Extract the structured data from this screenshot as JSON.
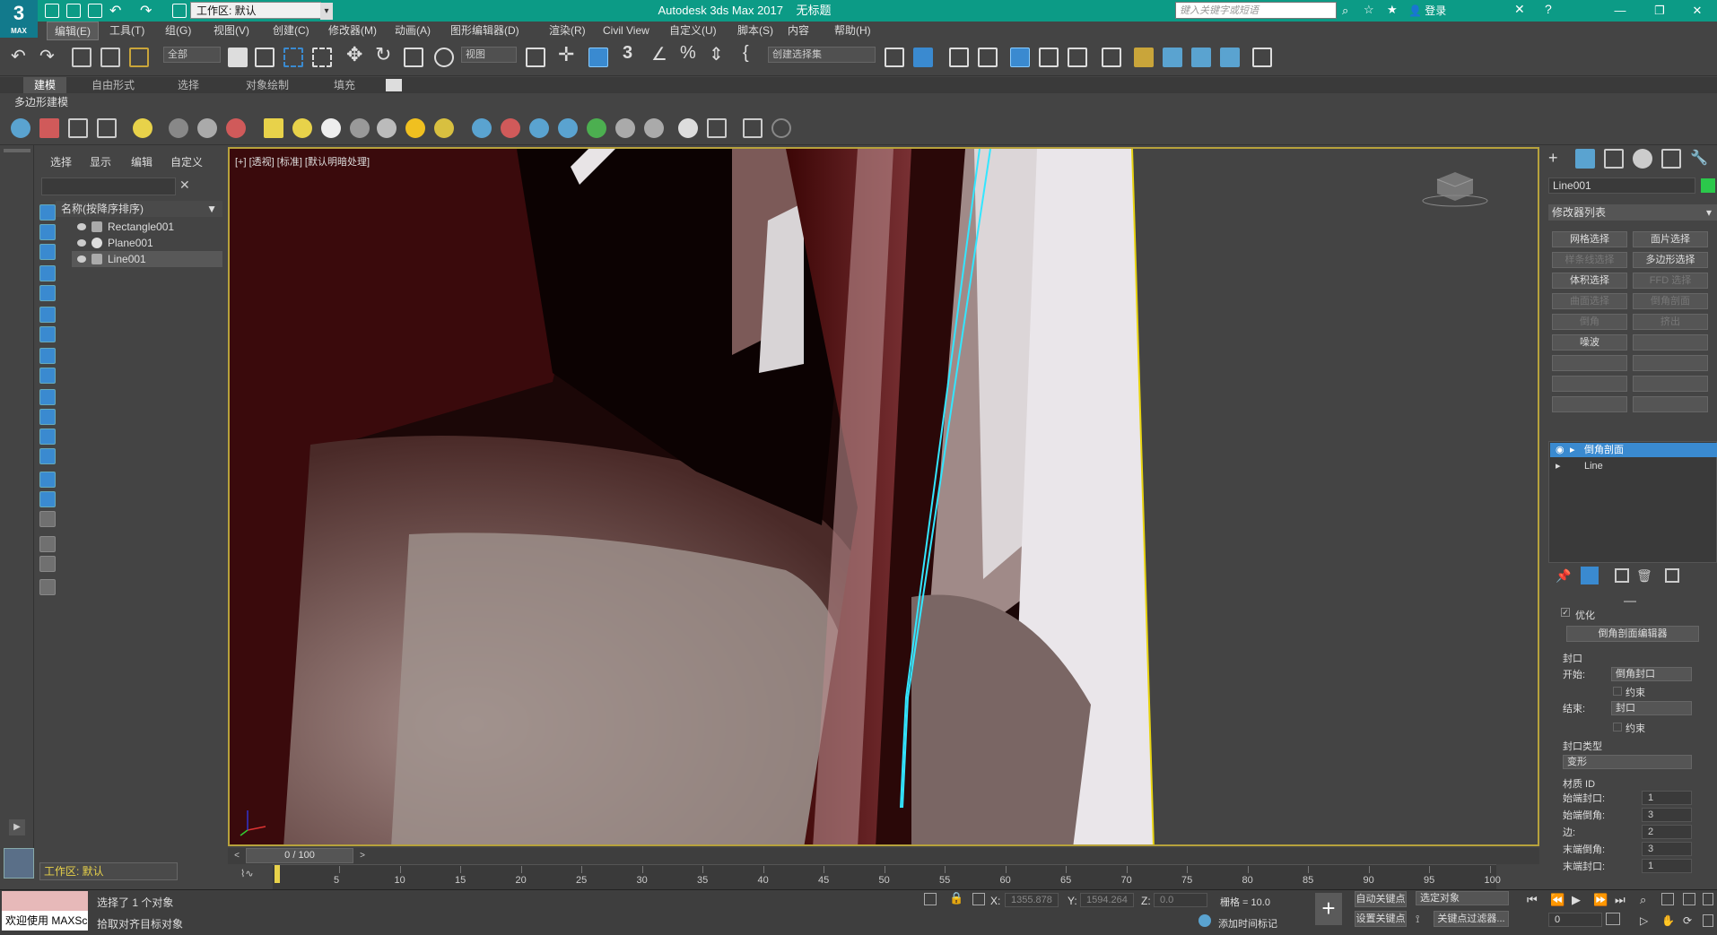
{
  "titlebar": {
    "workspace": "工作区: 默认",
    "app_title": "Autodesk 3ds Max 2017",
    "doc_title": "无标题",
    "search_placeholder": "键入关键字或短语",
    "login": "登录",
    "logo": "3",
    "logo_sub": "MAX"
  },
  "menus": [
    "编辑(E)",
    "工具(T)",
    "组(G)",
    "视图(V)",
    "创建(C)",
    "修改器(M)",
    "动画(A)",
    "图形编辑器(D)",
    "渲染(R)",
    "Civil View",
    "自定义(U)",
    "脚本(S)",
    "内容",
    "帮助(H)"
  ],
  "toolbar": {
    "selection_filter": "全部",
    "ref_coord": "视图",
    "named_selection": "创建选择集"
  },
  "ribbon": {
    "tabs": [
      "建模",
      "自由形式",
      "选择",
      "对象绘制",
      "填充"
    ],
    "sub": "多边形建模"
  },
  "scene_explorer": {
    "tabs": [
      "选择",
      "显示",
      "编辑",
      "自定义"
    ],
    "header": "名称(按降序排序)",
    "objects": [
      "Rectangle001",
      "Plane001",
      "Line001"
    ]
  },
  "viewport": {
    "label": "[+] [透视] [标准] [默认明暗处理]"
  },
  "command_panel": {
    "object_name": "Line001",
    "modifier_list": "修改器列表",
    "buttons": [
      {
        "label": "网格选择",
        "enabled": true
      },
      {
        "label": "面片选择",
        "enabled": true
      },
      {
        "label": "样条线选择",
        "enabled": false
      },
      {
        "label": "多边形选择",
        "enabled": true
      },
      {
        "label": "体积选择",
        "enabled": true
      },
      {
        "label": "FFD 选择",
        "enabled": false
      },
      {
        "label": "曲面选择",
        "enabled": false
      },
      {
        "label": "倒角剖面",
        "enabled": false
      },
      {
        "label": "倒角",
        "enabled": false
      },
      {
        "label": "挤出",
        "enabled": false
      },
      {
        "label": "噪波",
        "enabled": true
      },
      {
        "label": "",
        "enabled": true
      }
    ],
    "stack": [
      "倒角剖面",
      "Line"
    ],
    "params": {
      "optimize": "优化",
      "editor_btn": "倒角剖面编辑器",
      "cap_group": "封口",
      "start_label": "开始:",
      "start_value": "倒角封口",
      "constrain1": "约束",
      "end_label": "结束:",
      "end_value": "封口",
      "constrain2": "约束",
      "cap_type_group": "封口类型",
      "cap_type_value": "变形",
      "matid_group": "材质 ID",
      "ids": [
        {
          "label": "始端封口:",
          "value": "1"
        },
        {
          "label": "始端倒角:",
          "value": "3"
        },
        {
          "label": "边:",
          "value": "2"
        },
        {
          "label": "末端倒角:",
          "value": "3"
        },
        {
          "label": "末端封口:",
          "value": "1"
        }
      ]
    }
  },
  "timeline": {
    "slider": "0 / 100",
    "ticks": [
      "5",
      "10",
      "15",
      "20",
      "25",
      "30",
      "35",
      "40",
      "45",
      "50",
      "55",
      "60",
      "65",
      "70",
      "75",
      "80",
      "85",
      "90",
      "95",
      "100"
    ]
  },
  "status": {
    "workspace": "工作区: 默认",
    "maxscript": "欢迎使用 MAXSc",
    "line1": "选择了 1 个对象",
    "line2": "拾取对齐目标对象",
    "x_label": "X:",
    "x_value": "1355.878",
    "y_label": "Y:",
    "y_value": "1594.264",
    "z_label": "Z:",
    "z_value": "0.0",
    "grid": "栅格 = 10.0",
    "add_time_tag": "添加时间标记",
    "auto_key": "自动关键点",
    "set_key": "设置关键点",
    "selected_object": "选定对象",
    "key_filters": "关键点过滤器...",
    "frame": "0"
  }
}
